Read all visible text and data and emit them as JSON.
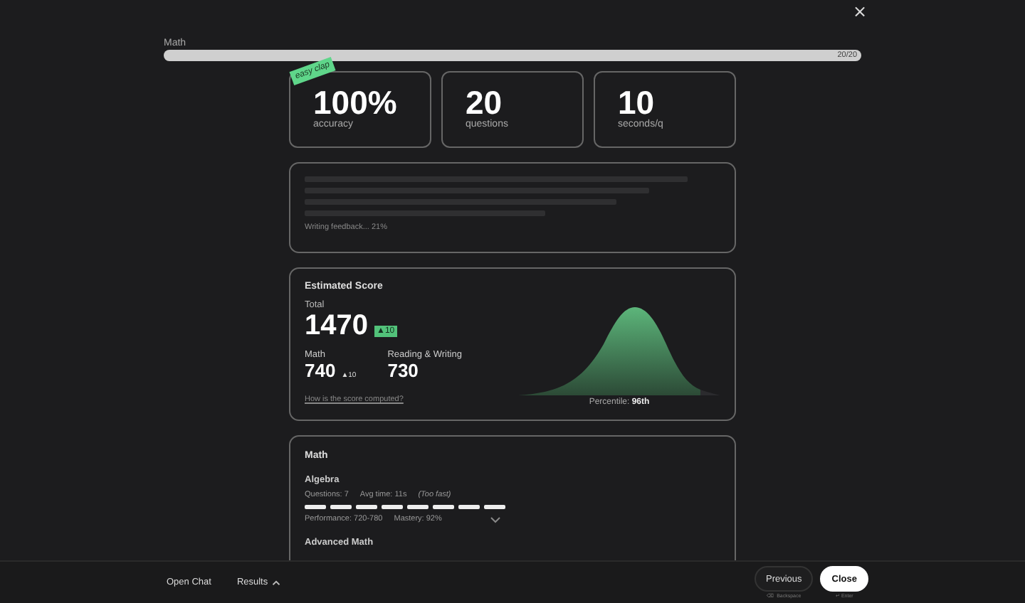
{
  "close_label": "×",
  "progress": {
    "title": "Math",
    "level": 1,
    "count": "20/20"
  },
  "badge": "easy clap",
  "stats": [
    {
      "value": "100%",
      "label": "accuracy"
    },
    {
      "value": "20",
      "label": "questions"
    },
    {
      "value": "10",
      "label": "seconds/q"
    }
  ],
  "feedback": {
    "status": "Writing feedback... 21%"
  },
  "score": {
    "title": "Estimated Score",
    "total_label": "Total",
    "total": "1470",
    "total_change": "▲10",
    "sections": [
      {
        "label": "Math",
        "value": "740",
        "change": "▲10"
      },
      {
        "label": "Reading & Writing",
        "value": "730"
      }
    ],
    "link": "How is the score computed?",
    "percentile": "Percentile: **96th**"
  },
  "breakdown": {
    "title": "Math",
    "domains": [
      {
        "name": "Algebra",
        "questions": "Questions: 7",
        "avg_time": "Avg time: 11s",
        "pace": "(Too fast)",
        "performance": "Performance: 720-780",
        "mastery": "Mastery: 92%",
        "expanded": false
      },
      {
        "name": "Advanced Math"
      }
    ]
  },
  "footer": {
    "left": [
      {
        "label": "Open Chat",
        "kind": "plain"
      },
      {
        "label": "Results",
        "kind": "menu",
        "expanded": false
      }
    ],
    "buttons": [
      {
        "label": "Previous",
        "hint": "⌫ Backspace",
        "primary": false
      },
      {
        "label": "Close",
        "hint": "↵ Enter",
        "primary": true
      }
    ]
  }
}
